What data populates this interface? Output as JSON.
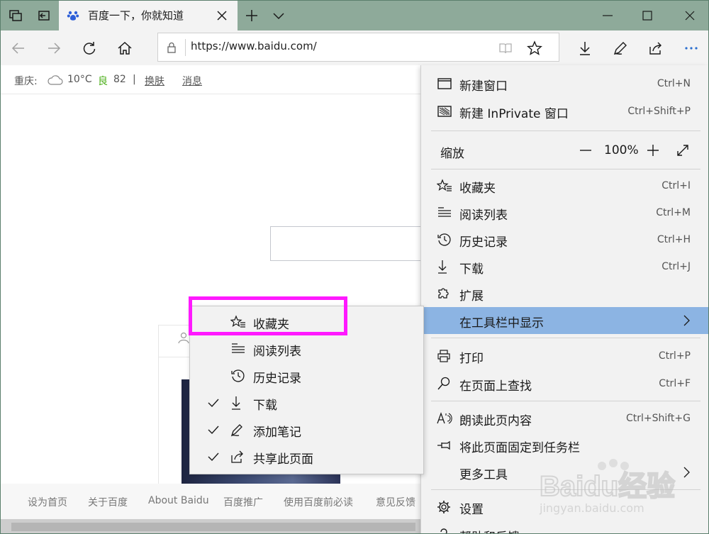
{
  "tab": {
    "title": "百度一下，你就知道"
  },
  "address": {
    "url": "https://www.baidu.com/"
  },
  "infobar": {
    "city": "重庆:",
    "temperature": "10°C",
    "air_quality_label": "良",
    "air_quality_value": "82",
    "divider": "|",
    "skin_link": "换肤",
    "messages_link": "消息"
  },
  "footer": {
    "links": [
      "设为首页",
      "关于百度",
      "About Baidu",
      "百度推广",
      "使用百度前必读",
      "意见反馈"
    ]
  },
  "menu": {
    "new_window": {
      "label": "新建窗口",
      "shortcut": "Ctrl+N"
    },
    "new_inprivate": {
      "label": "新建 InPrivate 窗口",
      "shortcut": "Ctrl+Shift+P"
    },
    "zoom": {
      "label": "缩放",
      "value": "100%"
    },
    "favorites": {
      "label": "收藏夹",
      "shortcut": "Ctrl+I"
    },
    "reading_list": {
      "label": "阅读列表",
      "shortcut": "Ctrl+M"
    },
    "history": {
      "label": "历史记录",
      "shortcut": "Ctrl+H"
    },
    "downloads": {
      "label": "下载",
      "shortcut": "Ctrl+J"
    },
    "extensions": {
      "label": "扩展"
    },
    "show_in_toolbar": {
      "label": "在工具栏中显示"
    },
    "print": {
      "label": "打印",
      "shortcut": "Ctrl+P"
    },
    "find": {
      "label": "在页面上查找",
      "shortcut": "Ctrl+F"
    },
    "read_aloud": {
      "label": "朗读此页内容",
      "shortcut": "Ctrl+Shift+G"
    },
    "pin_taskbar": {
      "label": "将此页面固定到任务栏"
    },
    "more_tools": {
      "label": "更多工具"
    },
    "settings": {
      "label": "设置"
    },
    "help": {
      "label": "帮助和反馈"
    }
  },
  "submenu": {
    "items": [
      {
        "label": "收藏夹",
        "checked": false
      },
      {
        "label": "阅读列表",
        "checked": false
      },
      {
        "label": "历史记录",
        "checked": false
      },
      {
        "label": "下载",
        "checked": true
      },
      {
        "label": "添加笔记",
        "checked": true
      },
      {
        "label": "共享此页面",
        "checked": true
      }
    ]
  },
  "watermark": {
    "brand": "Baidu经验",
    "url": "jingyan.baidu.com"
  },
  "colors": {
    "titlebar": "#8eaa9a",
    "menu_highlight": "#8cb4e3",
    "annotation": "#ff19ff"
  }
}
